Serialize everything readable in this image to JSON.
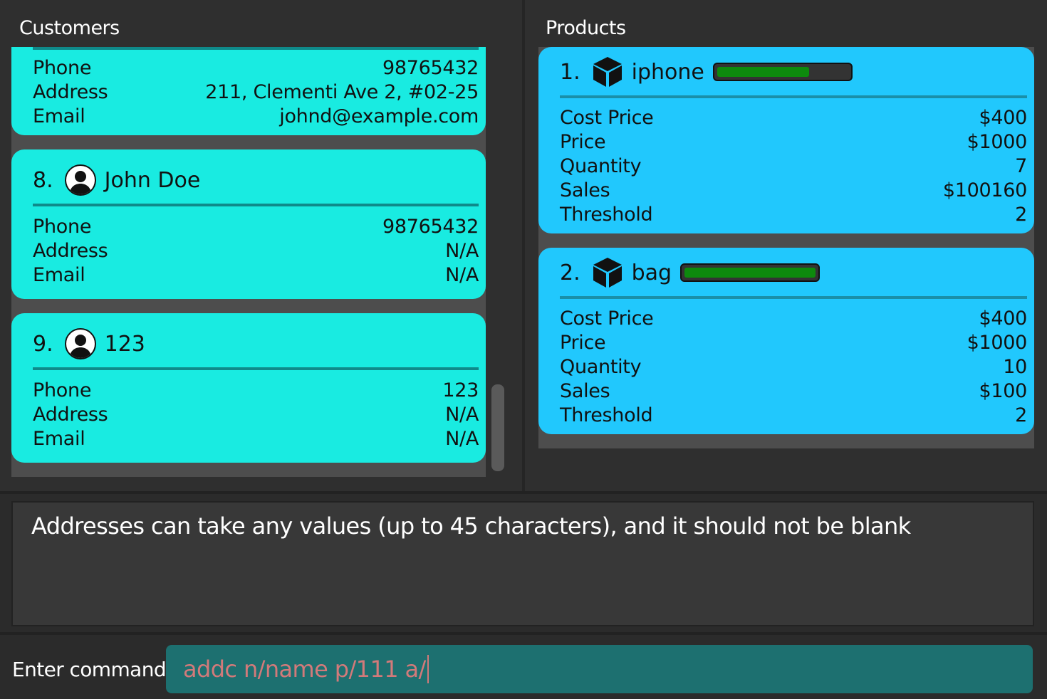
{
  "customers": {
    "title": "Customers",
    "top_partial": {
      "rows": [
        {
          "label": "Phone",
          "value": "98765432"
        },
        {
          "label": "Address",
          "value": "211, Clementi Ave 2, #02-25"
        },
        {
          "label": "Email",
          "value": "johnd@example.com"
        }
      ]
    },
    "cards": [
      {
        "index": "8.",
        "name": "John Doe",
        "rows": [
          {
            "label": "Phone",
            "value": "98765432"
          },
          {
            "label": "Address",
            "value": "N/A"
          },
          {
            "label": "Email",
            "value": "N/A"
          }
        ]
      },
      {
        "index": "9.",
        "name": "123",
        "rows": [
          {
            "label": "Phone",
            "value": "123"
          },
          {
            "label": "Address",
            "value": "N/A"
          },
          {
            "label": "Email",
            "value": "N/A"
          }
        ]
      }
    ]
  },
  "products": {
    "title": "Products",
    "cards": [
      {
        "index": "1.",
        "name": "iphone",
        "stock_level": 0.7,
        "rows": [
          {
            "label": "Cost Price",
            "value": "$400"
          },
          {
            "label": "Price",
            "value": "$1000"
          },
          {
            "label": "Quantity",
            "value": "7"
          },
          {
            "label": "Sales",
            "value": "$100160"
          },
          {
            "label": "Threshold",
            "value": "2"
          }
        ]
      },
      {
        "index": "2.",
        "name": "bag",
        "stock_level": 1.0,
        "rows": [
          {
            "label": "Cost Price",
            "value": "$400"
          },
          {
            "label": "Price",
            "value": "$1000"
          },
          {
            "label": "Quantity",
            "value": "10"
          },
          {
            "label": "Sales",
            "value": "$100"
          },
          {
            "label": "Threshold",
            "value": "2"
          }
        ]
      }
    ]
  },
  "result": {
    "text": "Addresses can take any values (up to 45 characters), and it should not be blank"
  },
  "command": {
    "label": "Enter command",
    "value": "addc n/name p/111 a/"
  },
  "icons": {
    "customer": "person-icon",
    "product": "box-icon"
  },
  "colors": {
    "customer_card": "#19ebe1",
    "product_card": "#21c8fd",
    "stock_fill": "#0d8a0d",
    "command_bg": "#1d7070",
    "command_text": "#d27a7a"
  }
}
